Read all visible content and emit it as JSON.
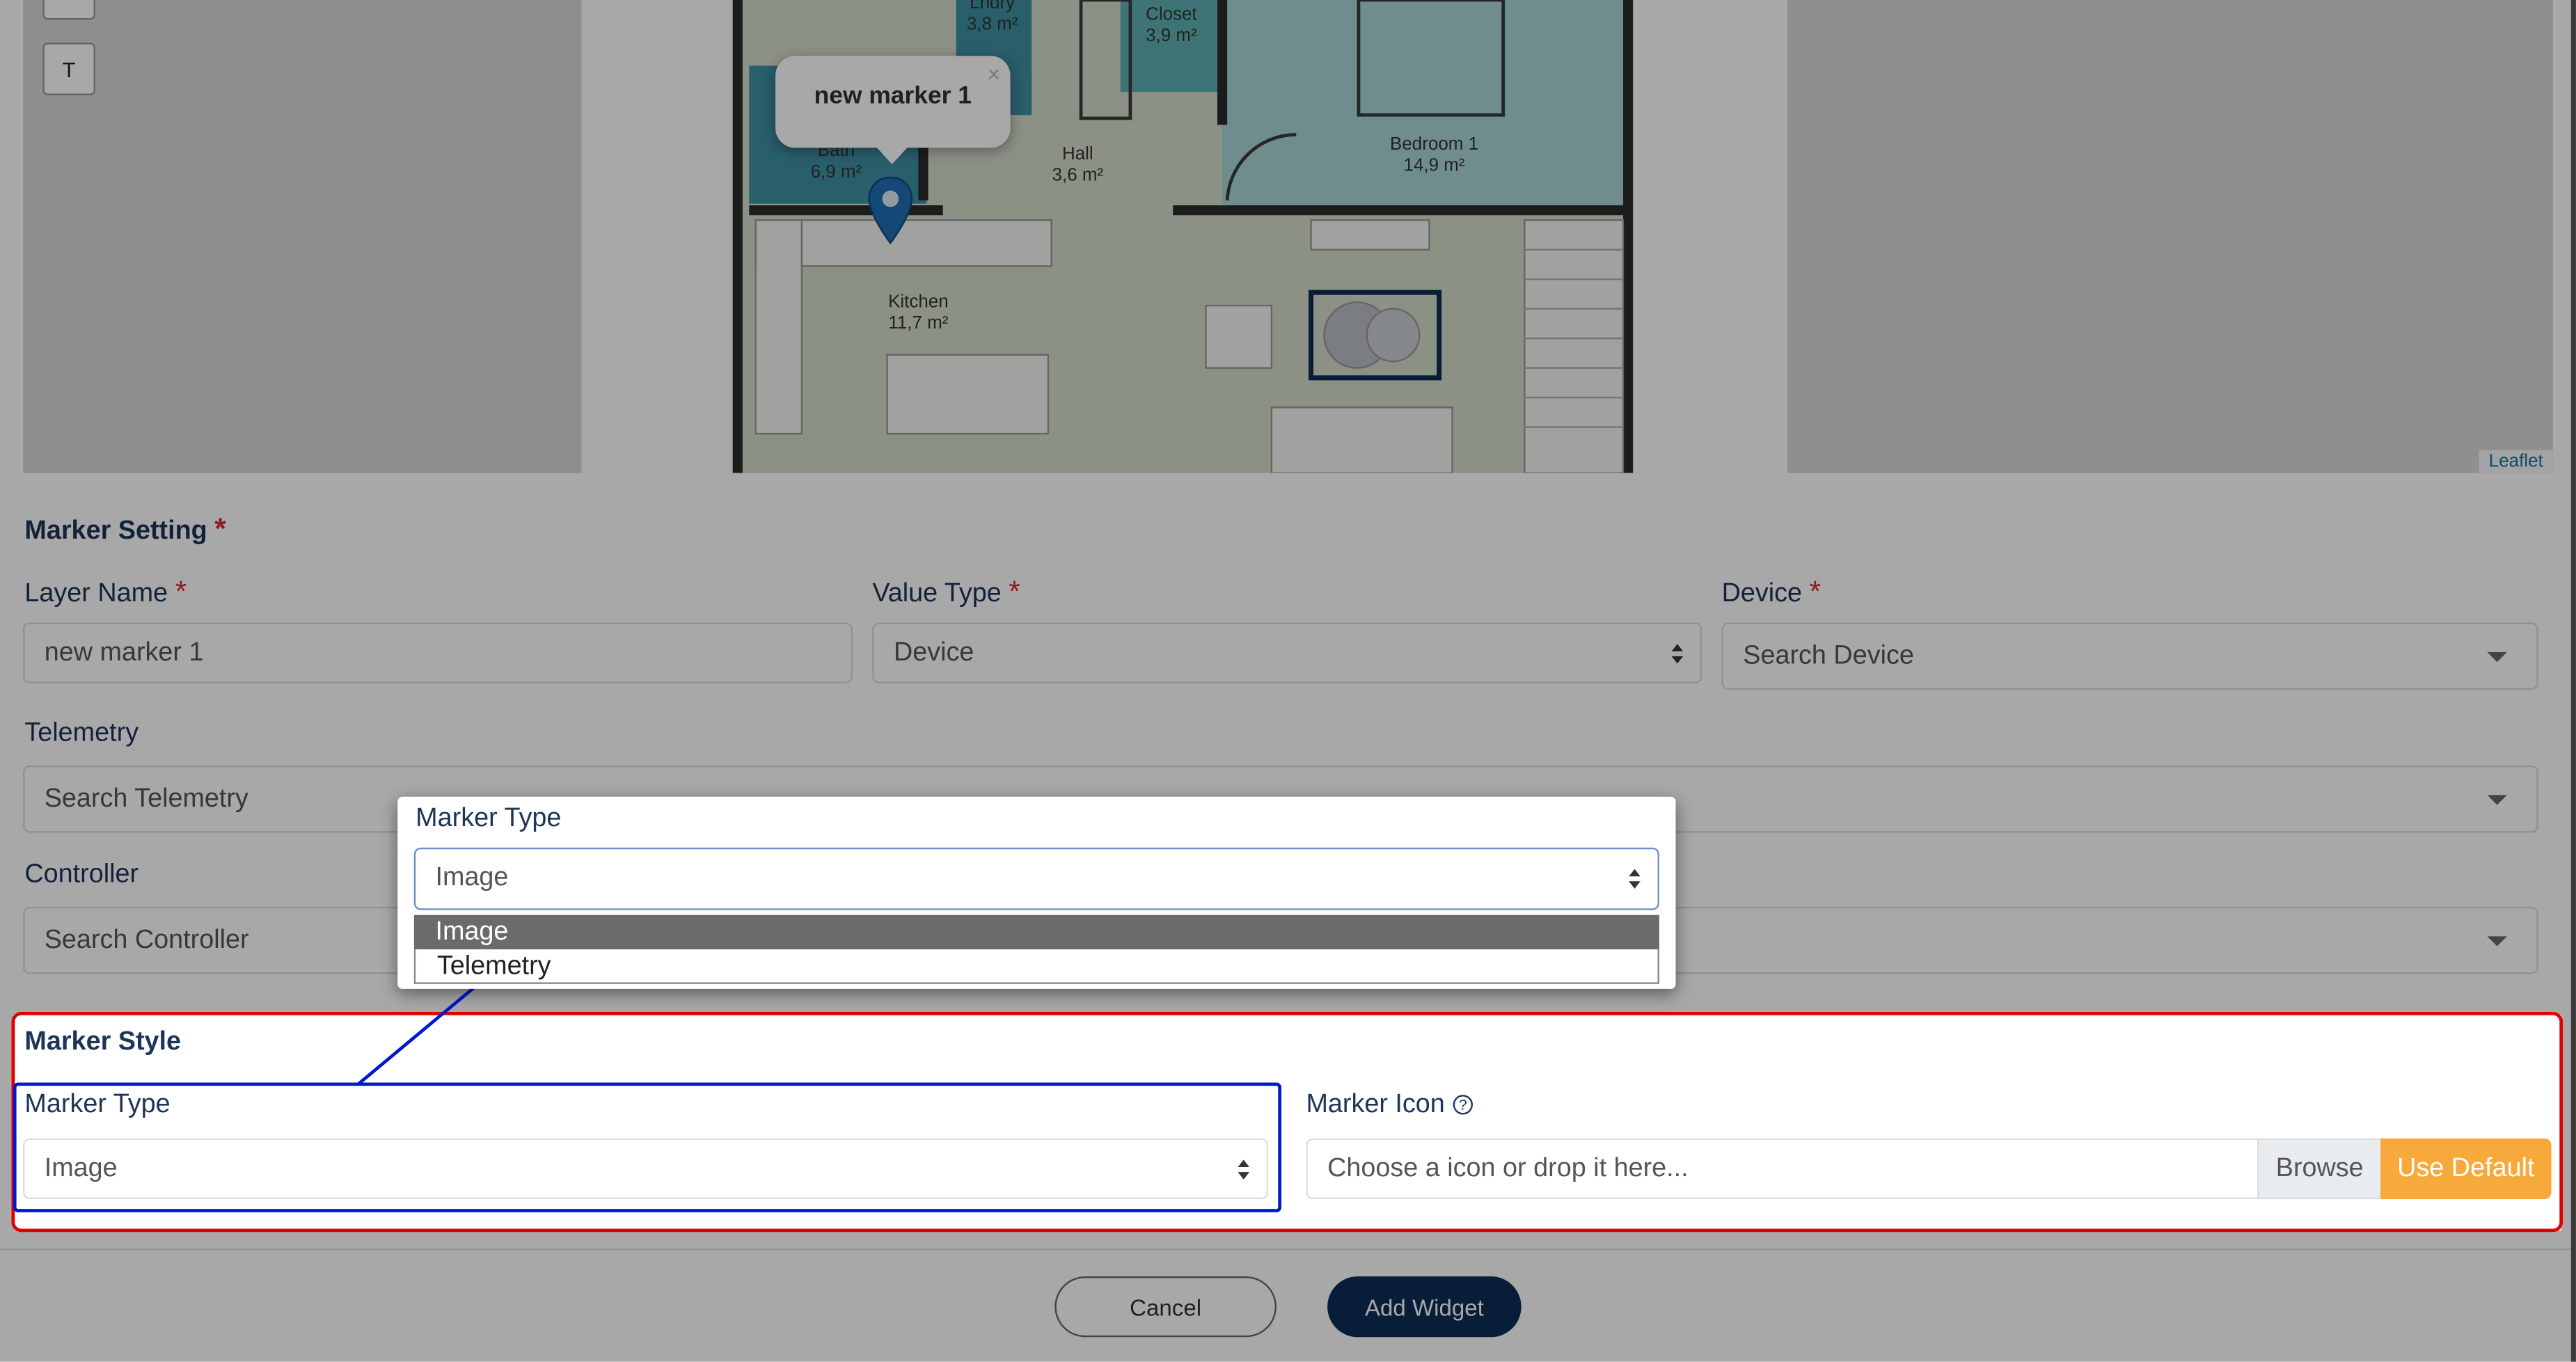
{
  "map": {
    "attribution": "Leaflet",
    "text_button": "T",
    "popup_title": "new marker 1",
    "popup_close": "×",
    "rooms": {
      "laundry_name": "Lndry",
      "laundry_area": "3,8 m²",
      "closet_name": "Closet",
      "closet_area": "3,9 m²",
      "bath_name": "Bath",
      "bath_area": "6,9 m²",
      "hall_name": "Hall",
      "hall_area": "3,6 m²",
      "bedroom_name": "Bedroom 1",
      "bedroom_area": "14,9 m²",
      "kitchen_name": "Kitchen",
      "kitchen_area": "11,7 m²"
    }
  },
  "marker_setting": {
    "title": "Marker Setting",
    "required_mark": "*",
    "layer_name": {
      "label": "Layer Name",
      "value": "new marker 1"
    },
    "value_type": {
      "label": "Value Type",
      "value": "Device"
    },
    "device": {
      "label": "Device",
      "placeholder": "Search Device"
    },
    "telemetry": {
      "label": "Telemetry",
      "placeholder": "Search Telemetry"
    },
    "controller": {
      "label": "Controller",
      "placeholder": "Search Controller"
    }
  },
  "marker_style": {
    "title": "Marker Style",
    "marker_type": {
      "label": "Marker Type",
      "value": "Image"
    },
    "marker_icon": {
      "label": "Marker Icon",
      "placeholder": "Choose a icon or drop it here...",
      "browse": "Browse",
      "use_default": "Use Default"
    }
  },
  "dropdown_callout": {
    "label": "Marker Type",
    "selected": "Image",
    "options": [
      "Image",
      "Telemetry"
    ]
  },
  "buttons": {
    "cancel": "Cancel",
    "add_widget": "Add Widget"
  },
  "colors": {
    "primary": "#0d2c54",
    "accent_orange": "#f7a93b",
    "highlight_red": "#e00000",
    "highlight_blue": "#0019ce",
    "marker_blue": "#1f6fb5"
  }
}
